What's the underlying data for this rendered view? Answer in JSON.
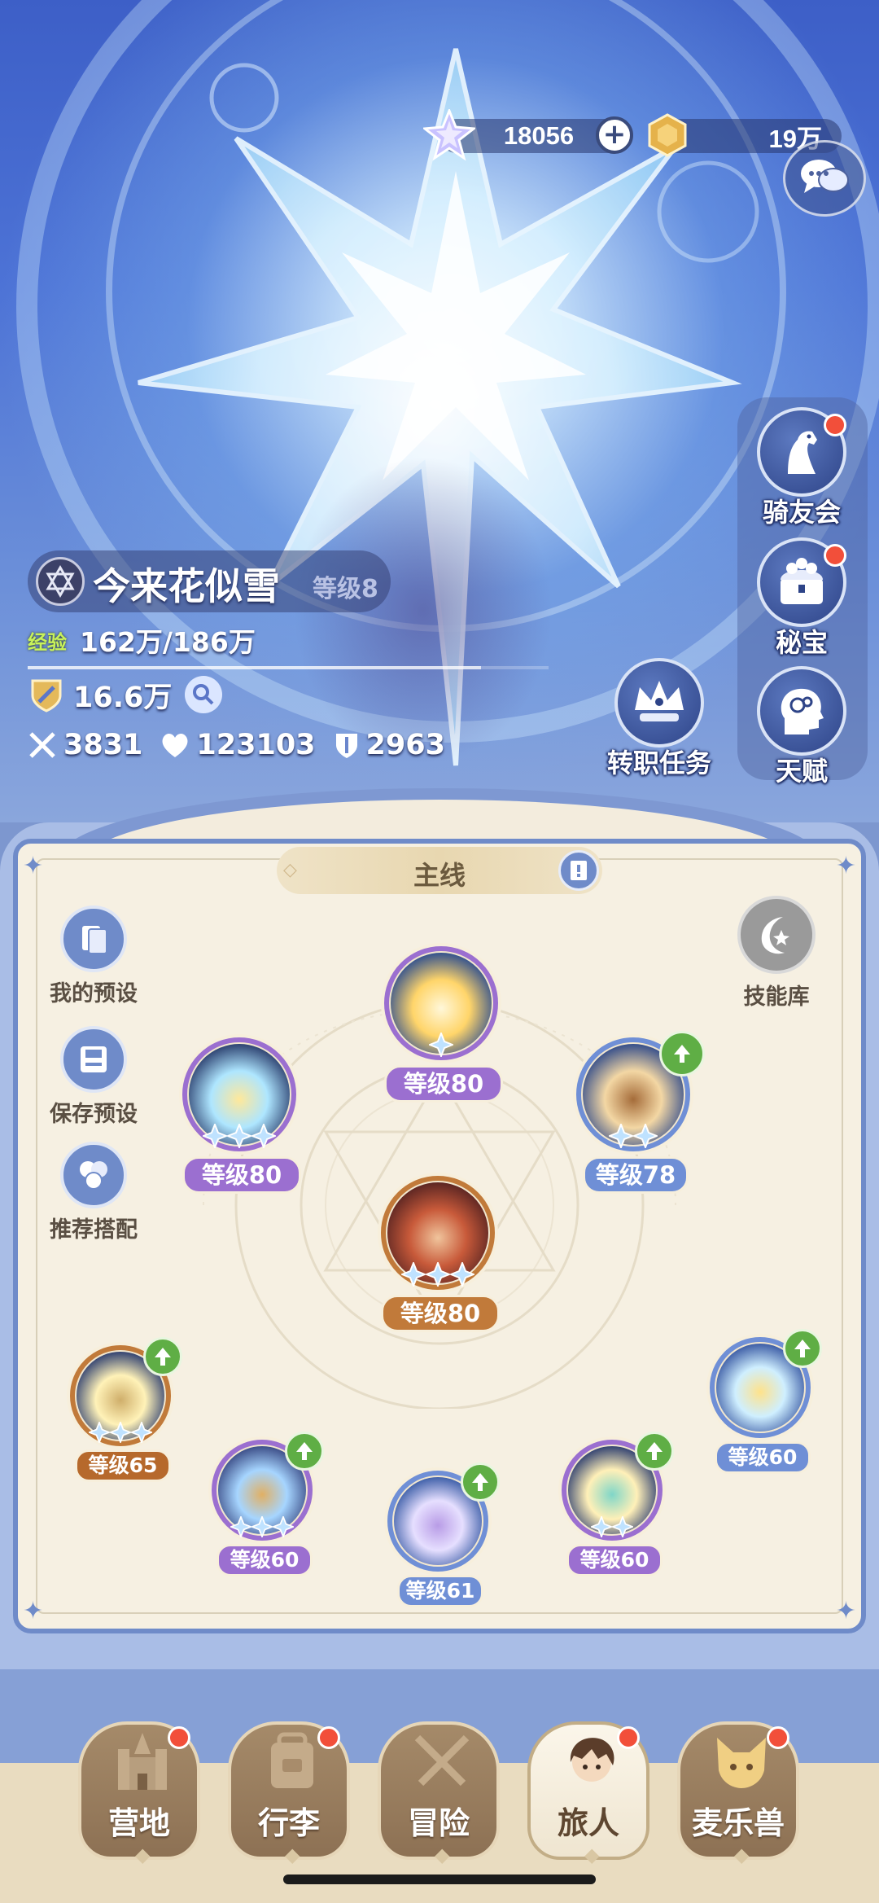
{
  "currency": {
    "gem_icon": "star-gem-icon",
    "gems": "18056",
    "coin_icon": "gold-coin-icon",
    "gold": "19万"
  },
  "player": {
    "name": "今来花似雪",
    "level": "等级8",
    "exp_label": "经验",
    "exp_value": "162万/186万",
    "exp_fraction": 0.871,
    "power": "16.6万",
    "attack": "3831",
    "hp": "123103",
    "defense": "2963"
  },
  "side_menu": [
    {
      "label": "骑友会",
      "icon": "horse-icon",
      "has_dot": true
    },
    {
      "label": "秘宝",
      "icon": "treasure-chest-icon",
      "has_dot": true
    },
    {
      "label": "天赋",
      "icon": "brain-head-icon",
      "has_dot": false
    }
  ],
  "job_quest": {
    "label": "转职任务",
    "icon": "crown-crest-icon"
  },
  "panel": {
    "tab_label": "主线",
    "left_actions": [
      {
        "label": "我的预设",
        "icon": "cards-icon"
      },
      {
        "label": "保存预设",
        "icon": "save-disk-icon"
      },
      {
        "label": "推荐搭配",
        "icon": "recommend-icon"
      }
    ],
    "skill_library": "技能库"
  },
  "skills": {
    "top": {
      "level": "等级80",
      "stars": 1
    },
    "left": {
      "level": "等级80",
      "stars": 3
    },
    "right": {
      "level": "等级78",
      "stars": 2,
      "upgradable": true
    },
    "center": {
      "level": "等级80",
      "stars": 3
    },
    "p1": {
      "level": "等级65",
      "stars": 3,
      "upgradable": true
    },
    "p2": {
      "level": "等级60",
      "stars": 3,
      "upgradable": true
    },
    "p3": {
      "level": "等级61",
      "stars": 0,
      "upgradable": true
    },
    "p4": {
      "level": "等级60",
      "stars": 2,
      "upgradable": true
    },
    "p5": {
      "level": "等级60",
      "stars": 0,
      "upgradable": true
    }
  },
  "bottom_nav": [
    {
      "label": "营地",
      "icon": "castle-icon",
      "has_dot": true,
      "active": false
    },
    {
      "label": "行李",
      "icon": "backpack-icon",
      "has_dot": true,
      "active": false
    },
    {
      "label": "冒险",
      "icon": "crossed-swords-icon",
      "has_dot": false,
      "active": false
    },
    {
      "label": "旅人",
      "icon": "traveler-avatar-icon",
      "has_dot": true,
      "active": true
    },
    {
      "label": "麦乐兽",
      "icon": "cat-pet-icon",
      "has_dot": true,
      "active": false
    }
  ],
  "colors": {
    "badge_purple": "#9b6fd0",
    "badge_blue": "#6f8fd6",
    "badge_brown": "#c17a3a",
    "badge_orange": "#b6692c"
  }
}
